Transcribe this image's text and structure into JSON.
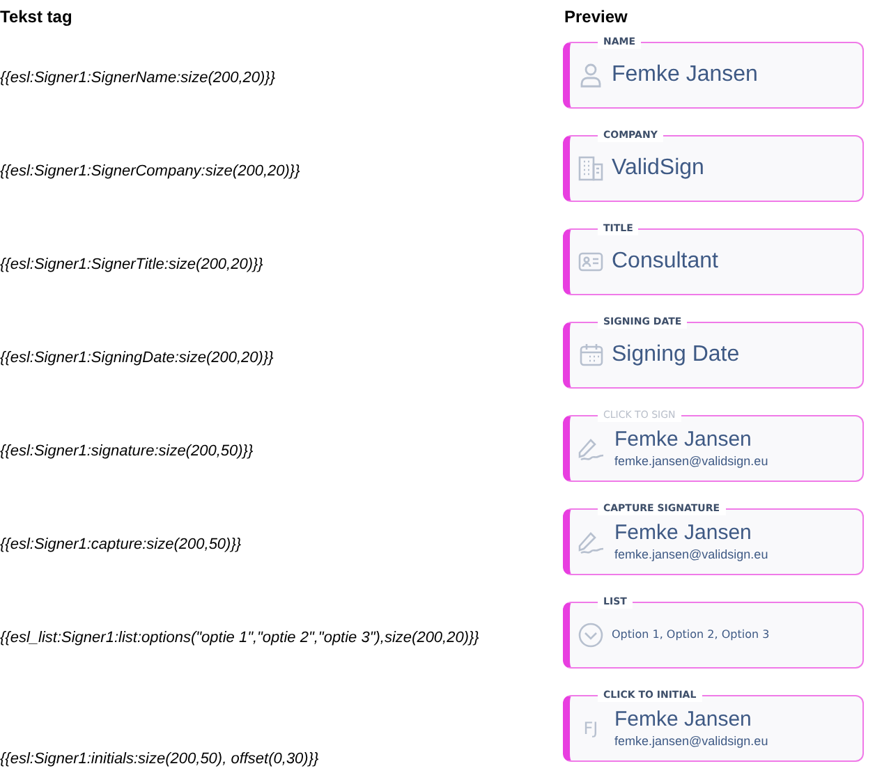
{
  "headers": {
    "tag": "Tekst tag",
    "preview": "Preview"
  },
  "rows": [
    {
      "tag": "{{esl:Signer1:SignerName:size(200,20)}}",
      "field": {
        "kind": "name",
        "label": "NAME",
        "label_dimmed": false,
        "value": "Femke Jansen"
      }
    },
    {
      "tag": "{{esl:Signer1:SignerCompany:size(200,20)}}",
      "field": {
        "kind": "company",
        "label": "COMPANY",
        "label_dimmed": false,
        "value": "ValidSign"
      }
    },
    {
      "tag": "{{esl:Signer1:SignerTitle:size(200,20)}}",
      "field": {
        "kind": "title",
        "label": "TITLE",
        "label_dimmed": false,
        "value": "Consultant"
      }
    },
    {
      "tag": "{{esl:Signer1:SigningDate:size(200,20)}}",
      "field": {
        "kind": "date",
        "label": "SIGNING DATE",
        "label_dimmed": false,
        "value": "Signing Date"
      }
    },
    {
      "tag": "{{esl:Signer1:signature:size(200,50)}}",
      "field": {
        "kind": "signature",
        "label": "CLICK TO SIGN",
        "label_dimmed": true,
        "value": "Femke Jansen",
        "email": "femke.jansen@validsign.eu"
      }
    },
    {
      "tag": "{{esl:Signer1:capture:size(200,50)}}",
      "field": {
        "kind": "signature",
        "label": "CAPTURE SIGNATURE",
        "label_dimmed": false,
        "value": "Femke Jansen",
        "email": "femke.jansen@validsign.eu"
      }
    },
    {
      "tag": "{{esl_list:Signer1:list:options(\"optie 1\",\"optie 2\",\"optie 3\"),size(200,20)}}",
      "field": {
        "kind": "list",
        "label": "LIST",
        "label_dimmed": false,
        "value": "Option 1, Option 2, Option 3"
      }
    },
    {
      "tag": "{{esl:Signer1:initials:size(200,50), offset(0,30)}}",
      "field": {
        "kind": "initials",
        "label": "CLICK TO INITIAL",
        "label_dimmed": false,
        "initials": "FJ",
        "value": "Femke Jansen",
        "email": "femke.jansen@validsign.eu"
      }
    }
  ]
}
